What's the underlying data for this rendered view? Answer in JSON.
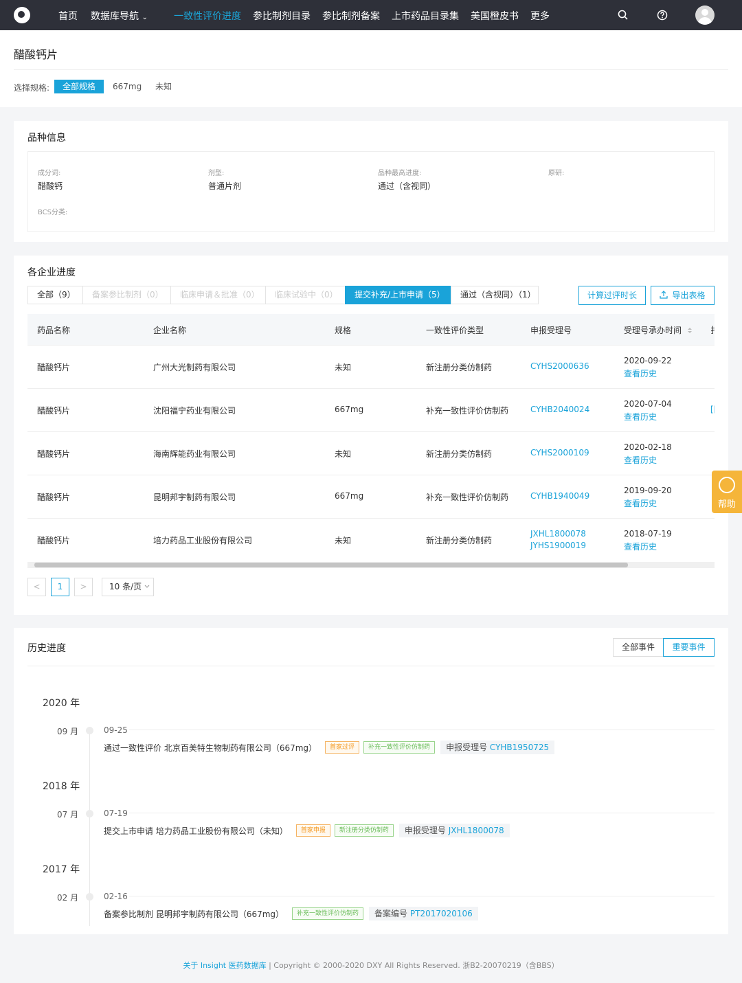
{
  "nav": {
    "items": [
      "首页",
      "数据库导航",
      "一致性评价进度",
      "参比制剂目录",
      "参比制剂备案",
      "上市药品目录集",
      "美国橙皮书",
      "更多"
    ],
    "dropdown_caret": "⌄"
  },
  "page": {
    "title": "醋酸钙片",
    "spec_label": "选择规格:",
    "specs": [
      "全部规格",
      "667mg",
      "未知"
    ]
  },
  "variety": {
    "title": "品种信息",
    "fields": [
      {
        "label": "成分词:",
        "value": "醋酸钙"
      },
      {
        "label": "剂型:",
        "value": "普通片剂"
      },
      {
        "label": "品种最高进度:",
        "value": "通过（含视同）"
      },
      {
        "label": "原研:",
        "value": ""
      },
      {
        "label": "BCS分类:",
        "value": ""
      }
    ]
  },
  "progress": {
    "title": "各企业进度",
    "tabs": [
      "全部（9）",
      "备案参比制剂（0）",
      "临床申请＆批准（0）",
      "临床试验中（0）",
      "提交补充/上市申请（5）",
      "通过（含视同）（1）"
    ],
    "btn_calc": "计算过评时长",
    "btn_export": "导出表格",
    "columns": [
      "药品名称",
      "企业名称",
      "规格",
      "一致性评价类型",
      "申报受理号",
      "受理号承办时间",
      "扌"
    ],
    "rows": [
      {
        "drug": "醋酸钙片",
        "company": "广州大光制药有限公司",
        "spec": "未知",
        "type": "新注册分类仿制药",
        "codes": [
          "CYHS2000636"
        ],
        "date": "2020-09-22",
        "history": "查看历史",
        "extra": ""
      },
      {
        "drug": "醋酸钙片",
        "company": "沈阳福宁药业有限公司",
        "spec": "667mg",
        "type": "补充一致性评价仿制药",
        "codes": [
          "CYHB2040024"
        ],
        "date": "2020-07-04",
        "history": "查看历史",
        "extra": "[["
      },
      {
        "drug": "醋酸钙片",
        "company": "海南辉能药业有限公司",
        "spec": "未知",
        "type": "新注册分类仿制药",
        "codes": [
          "CYHS2000109"
        ],
        "date": "2020-02-18",
        "history": "查看历史",
        "extra": ""
      },
      {
        "drug": "醋酸钙片",
        "company": "昆明邦宇制药有限公司",
        "spec": "667mg",
        "type": "补充一致性评价仿制药",
        "codes": [
          "CYHB1940049"
        ],
        "date": "2019-09-20",
        "history": "查看历史",
        "extra": ""
      },
      {
        "drug": "醋酸钙片",
        "company": "培力药品工业股份有限公司",
        "spec": "未知",
        "type": "新注册分类仿制药",
        "codes": [
          "JXHL1800078",
          "JYHS1900019"
        ],
        "date": "2018-07-19",
        "history": "查看历史",
        "extra": ""
      }
    ],
    "pagination": {
      "current": "1",
      "prev": "<",
      "next": ">",
      "page_size": "10 条/页"
    }
  },
  "history": {
    "title": "历史进度",
    "filters": [
      "全部事件",
      "重要事件"
    ],
    "groups": [
      {
        "year": "2020 年",
        "month": "09 月",
        "date": "09-25",
        "text": "通过一致性评价 北京百美特生物制药有限公司（667mg）",
        "tags": [
          {
            "label": "首家过评",
            "color": "orange"
          },
          {
            "label": "补充一致性评价仿制药",
            "color": "green"
          }
        ],
        "code_label": "申报受理号",
        "code": "CYHB1950725"
      },
      {
        "year": "2018 年",
        "month": "07 月",
        "date": "07-19",
        "text": "提交上市申请 培力药品工业股份有限公司（未知）",
        "tags": [
          {
            "label": "首家申报",
            "color": "orange"
          },
          {
            "label": "新注册分类仿制药",
            "color": "green"
          }
        ],
        "code_label": "申报受理号",
        "code": "JXHL1800078"
      },
      {
        "year": "2017 年",
        "month": "02 月",
        "date": "02-16",
        "text": "备案参比制剂 昆明邦宇制药有限公司（667mg）",
        "tags": [
          {
            "label": "补充一致性评价仿制药",
            "color": "green"
          }
        ],
        "code_label": "备案编号",
        "code": "PT2017020106"
      }
    ]
  },
  "footer": {
    "link": "关于 Insight 医药数据库",
    "text": "|  Copyright © 2000-2020 DXY All Rights Reserved. 浙B2-20070219（含BBS）"
  },
  "help": {
    "label": "帮助"
  },
  "colors": {
    "accent": "#1aa3d9",
    "nav_bg": "#2e3039",
    "tag_orange": "#f59a23",
    "tag_green": "#6bbd5b",
    "help_bg": "#f5b53a"
  }
}
